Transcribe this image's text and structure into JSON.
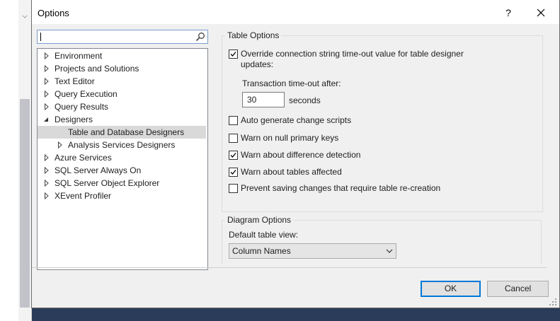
{
  "window": {
    "title": "Options",
    "help": "?",
    "close_icon": "close-icon"
  },
  "search": {
    "value": "",
    "icon": "search-icon"
  },
  "tree": {
    "items": [
      {
        "label": "Environment",
        "expanded": false,
        "level": 0
      },
      {
        "label": "Projects and Solutions",
        "expanded": false,
        "level": 0
      },
      {
        "label": "Text Editor",
        "expanded": false,
        "level": 0
      },
      {
        "label": "Query Execution",
        "expanded": false,
        "level": 0
      },
      {
        "label": "Query Results",
        "expanded": false,
        "level": 0
      },
      {
        "label": "Designers",
        "expanded": true,
        "level": 0
      },
      {
        "label": "Table and Database Designers",
        "selected": true,
        "level": 1
      },
      {
        "label": "Analysis Services Designers",
        "expanded": false,
        "level": 1
      },
      {
        "label": "Azure Services",
        "expanded": false,
        "level": 0
      },
      {
        "label": "SQL Server Always On",
        "expanded": false,
        "level": 0
      },
      {
        "label": "SQL Server Object Explorer",
        "expanded": false,
        "level": 0
      },
      {
        "label": "XEvent Profiler",
        "expanded": false,
        "level": 0
      }
    ]
  },
  "table_options": {
    "group_label": "Table Options",
    "override_timeout": {
      "line1": "Override connection string time-out value for table designer",
      "line2": "updates:",
      "checked": true
    },
    "transaction_timeout_label": "Transaction time-out after:",
    "transaction_timeout_value": "30",
    "seconds_label": "seconds",
    "checkboxes": [
      {
        "label": "Auto generate change scripts",
        "checked": false
      },
      {
        "label": "Warn on null primary keys",
        "checked": false
      },
      {
        "label": "Warn about difference detection",
        "checked": true
      },
      {
        "label": "Warn about tables affected",
        "checked": true
      },
      {
        "label": "Prevent saving changes that require table re-creation",
        "checked": false
      }
    ]
  },
  "diagram_options": {
    "group_label": "Diagram Options",
    "default_view_label": "Default table view:",
    "default_view_value": "Column Names"
  },
  "buttons": {
    "ok": "OK",
    "cancel": "Cancel"
  },
  "colors": {
    "accent": "#0078d7",
    "selection": "#d9d9d9",
    "dialog_bg": "#f0f0f0",
    "backdrop": "#2b3c5a"
  }
}
